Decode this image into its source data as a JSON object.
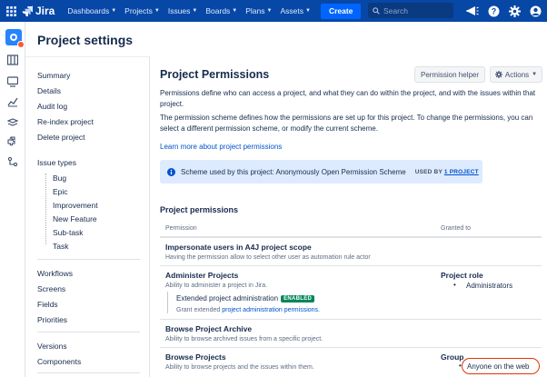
{
  "topnav": {
    "brand": "Jira",
    "menu": [
      "Dashboards",
      "Projects",
      "Issues",
      "Boards",
      "Plans",
      "Assets"
    ],
    "create_label": "Create",
    "search_placeholder": "Search",
    "icons": [
      "app-switcher-icon",
      "notifications-icon",
      "help-icon",
      "settings-icon",
      "profile-icon"
    ]
  },
  "rail": {
    "icons": [
      "project-avatar-icon",
      "board-icon",
      "tv-icon",
      "chart-icon",
      "layers-icon",
      "component-icon",
      "shortcuts-icon"
    ]
  },
  "page_title": "Project settings",
  "settings_nav": {
    "group1": [
      "Summary",
      "Details",
      "Audit log",
      "Re-index project",
      "Delete project"
    ],
    "issue_types_label": "Issue types",
    "issue_types": [
      "Bug",
      "Epic",
      "Improvement",
      "New Feature",
      "Sub-task",
      "Task"
    ],
    "group2": [
      "Workflows",
      "Screens",
      "Fields",
      "Priorities"
    ],
    "group3": [
      "Versions",
      "Components"
    ]
  },
  "main": {
    "title": "Project Permissions",
    "permission_helper": "Permission helper",
    "actions": "Actions",
    "para1": "Permissions define who can access a project, and what they can do within the project, and with the issues within that project.",
    "para2": "The permission scheme defines how the permissions are set up for this project. To change the permissions, you can select a different permission scheme, or modify the current scheme.",
    "learn_more": "Learn more about project permissions",
    "scheme_text": "Scheme used by this project: Anonymously Open Permission Scheme",
    "used_by_prefix": "USED BY",
    "used_by_link": "1 PROJECT",
    "section_heading": "Project permissions",
    "col_permission": "Permission",
    "col_granted": "Granted to",
    "rows": [
      {
        "name": "Impersonate users in A4J project scope",
        "desc": "Having the permission allow to select other user as automation rule actor"
      },
      {
        "name": "Administer Projects",
        "desc": "Ability to administer a project in Jira.",
        "grant_heading": "Project role",
        "grant_items": [
          "Administrators"
        ]
      },
      {
        "name": "Browse Project Archive",
        "desc": "Ability to browse archived issues from a specific project."
      },
      {
        "name": "Browse Projects",
        "desc": "Ability to browse projects and the issues within them.",
        "grant_heading": "Group",
        "grant_items": [
          "Anyone on the web"
        ]
      }
    ],
    "extended": {
      "name": "Extended project administration",
      "badge": "ENABLED",
      "desc_prefix": "Grant extended",
      "desc_link": "project administration permissions."
    }
  },
  "colors": {
    "nav_bg": "#0747a6",
    "create_bg": "#0065ff",
    "link": "#0052cc",
    "info_bg": "#deebff",
    "enabled_badge": "#00875a",
    "highlight_circle": "#de350b"
  }
}
